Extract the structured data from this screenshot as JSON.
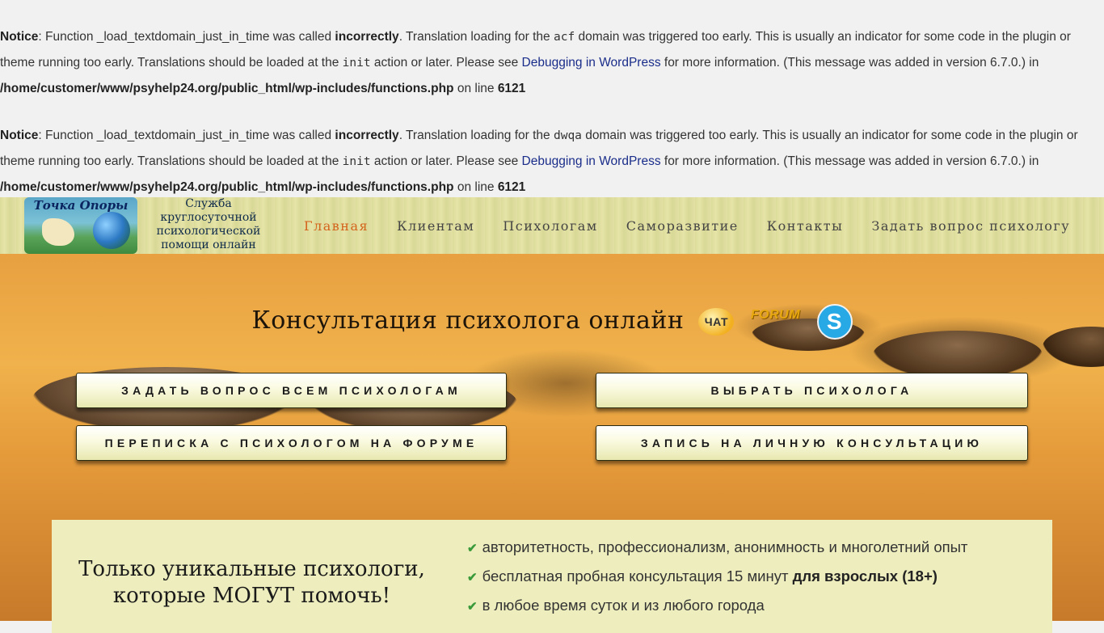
{
  "notices": [
    {
      "label": "Notice",
      "text1": ": Function _load_textdomain_just_in_time was called ",
      "bold1": "incorrectly",
      "text2": ". Translation loading for the ",
      "code1": "acf",
      "text3": " domain was triggered too early. This is usually an indicator for some code in the plugin or theme running too early. Translations should be loaded at the ",
      "code2": "init",
      "text4": " action or later. Please see ",
      "link": "Debugging in WordPress",
      "text5": " for more information. (This message was added in version 6.7.0.) in ",
      "path": "/home/customer/www/psyhelp24.org/public_html/wp-includes/functions.php",
      "text6": " on line ",
      "line": "6121"
    },
    {
      "label": "Notice",
      "text1": ": Function _load_textdomain_just_in_time was called ",
      "bold1": "incorrectly",
      "text2": ". Translation loading for the ",
      "code1": "dwqa",
      "text3": " domain was triggered too early. This is usually an indicator for some code in the plugin or theme running too early. Translations should be loaded at the ",
      "code2": "init",
      "text4": " action or later. Please see ",
      "link": "Debugging in WordPress",
      "text5": " for more information. (This message was added in version 6.7.0.) in ",
      "path": "/home/customer/www/psyhelp24.org/public_html/wp-includes/functions.php",
      "text6": " on line ",
      "line": "6121"
    }
  ],
  "header": {
    "logo_title": "Точка Опоры",
    "service": "Служба круглосуточной психологической помощи онлайн",
    "nav": [
      "Главная",
      "Клиентам",
      "Психологам",
      "Саморазвитие",
      "Контакты",
      "Задать вопрос психологу"
    ]
  },
  "hero": {
    "title": "Консультация психолога онлайн",
    "icon_chat": "ЧАТ",
    "icon_forum": "FORUM",
    "icon_skype": "S",
    "buttons": [
      "ЗАДАТЬ ВОПРОС ВСЕМ ПСИХОЛОГАМ",
      "ВЫБРАТЬ ПСИХОЛОГА",
      "ПЕРЕПИСКА С ПСИХОЛОГОМ НА ФОРУМЕ",
      "ЗАПИСЬ НА ЛИЧНУЮ КОНСУЛЬТАЦИЮ"
    ]
  },
  "panel": {
    "title": "Только уникальные психологи, которые МОГУТ помочь!",
    "features": [
      {
        "text": "авторитетность, профессионализм, анонимность и многолетний опыт",
        "bold": ""
      },
      {
        "text": "бесплатная пробная консультация 15 минут ",
        "bold": "для взрослых (18+)"
      },
      {
        "text": "в любое время суток и из любого города",
        "bold": ""
      }
    ]
  },
  "colors": {
    "nav_active": "#d4631c",
    "link": "#1a2d8a",
    "panel_bg": "#ededbd",
    "check": "#3a9a3a"
  }
}
